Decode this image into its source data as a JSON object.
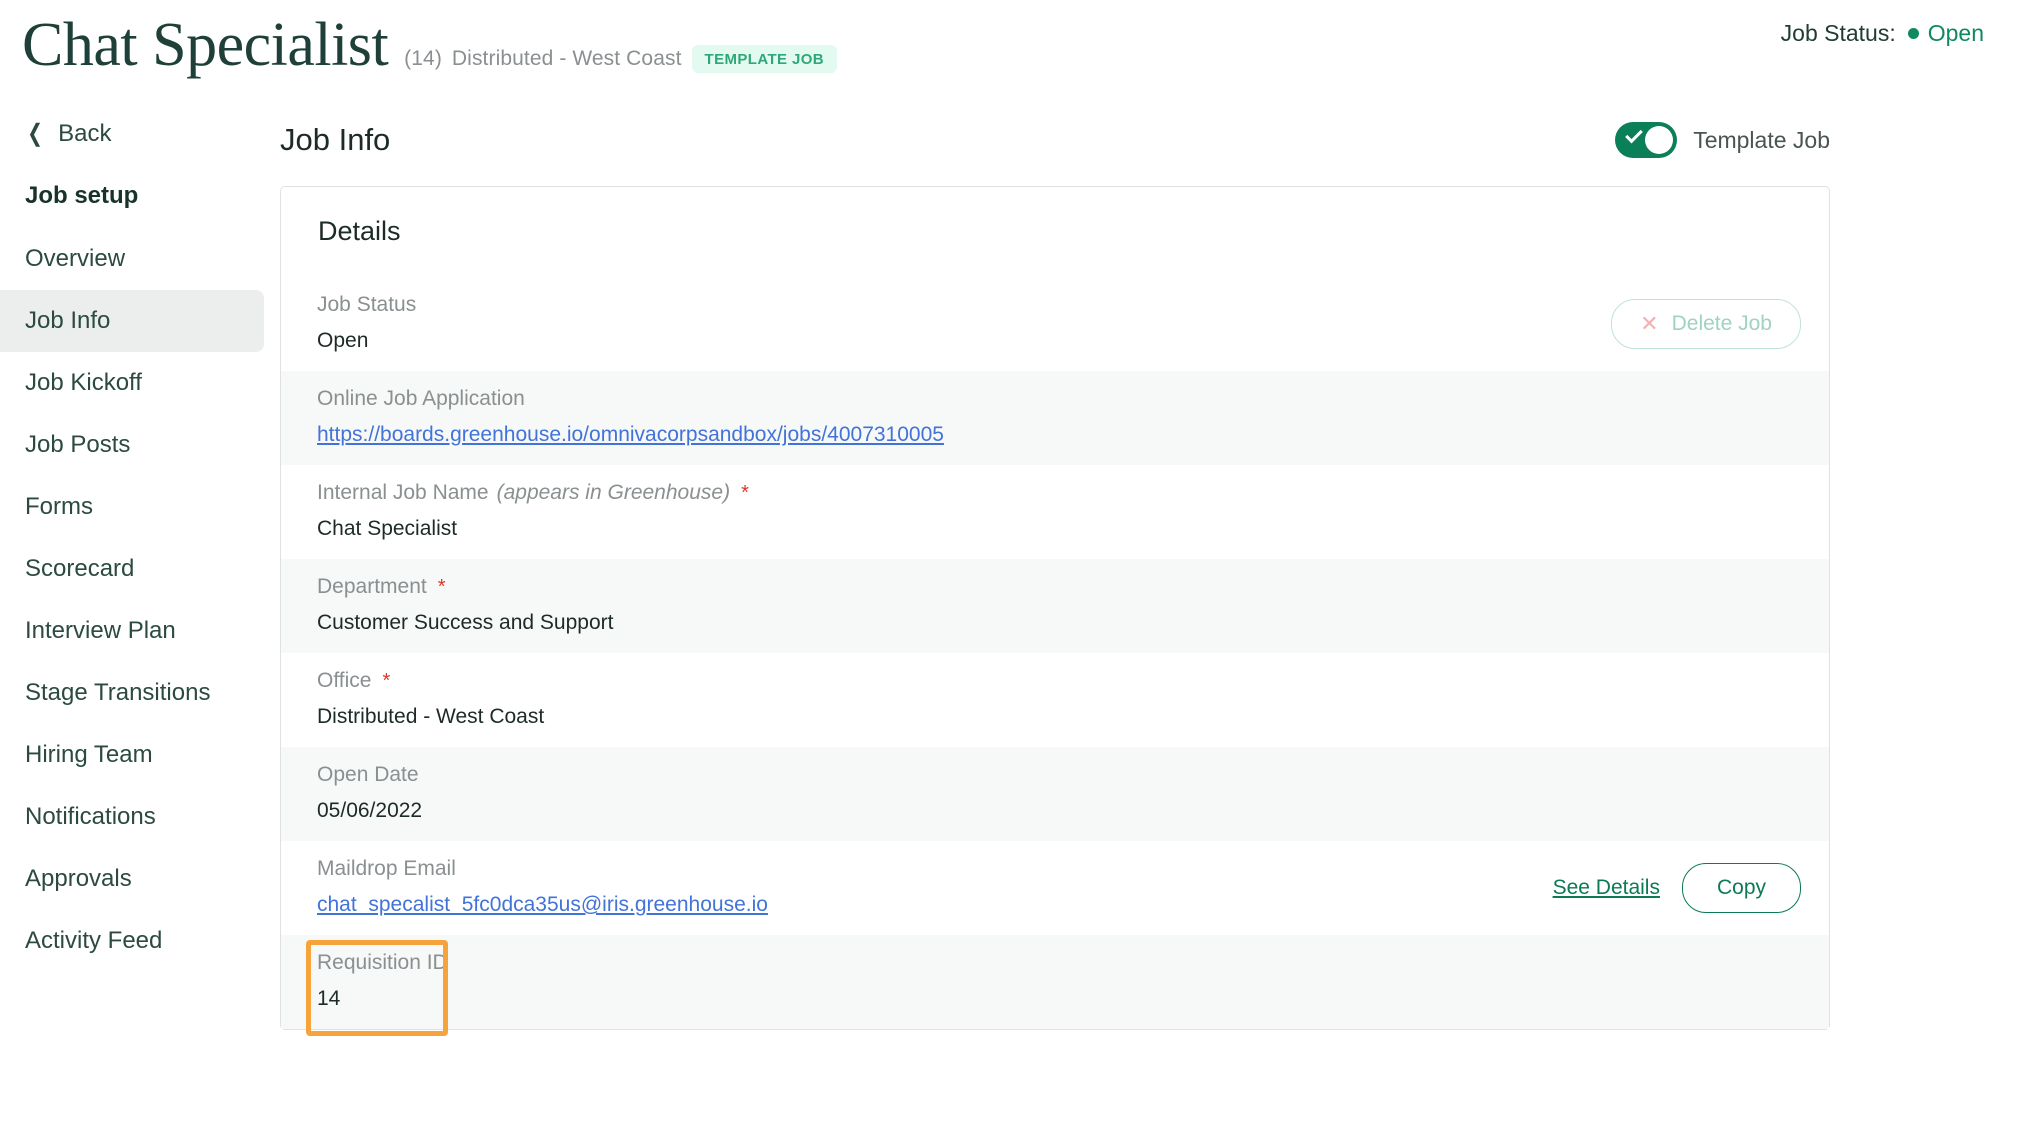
{
  "header": {
    "title": "Chat Specialist",
    "count": "(14)",
    "office": "Distributed - West Coast",
    "badge": "TEMPLATE JOB",
    "status_label": "Job Status:",
    "status_value": "Open",
    "status_color": "#0f8a5f",
    "badge_bg": "#e2faf0",
    "badge_color": "#2ea87a"
  },
  "sidebar": {
    "back_label": "Back",
    "back_icon": "chevron-left-icon",
    "heading": "Job setup",
    "items": [
      {
        "label": "Overview",
        "active": false
      },
      {
        "label": "Job Info",
        "active": true
      },
      {
        "label": "Job Kickoff",
        "active": false
      },
      {
        "label": "Job Posts",
        "active": false
      },
      {
        "label": "Forms",
        "active": false
      },
      {
        "label": "Scorecard",
        "active": false
      },
      {
        "label": "Interview Plan",
        "active": false
      },
      {
        "label": "Stage Transitions",
        "active": false
      },
      {
        "label": "Hiring Team",
        "active": false
      },
      {
        "label": "Notifications",
        "active": false
      },
      {
        "label": "Approvals",
        "active": false
      },
      {
        "label": "Activity Feed",
        "active": false
      }
    ]
  },
  "main": {
    "title": "Job Info",
    "toggle": {
      "label": "Template Job",
      "state": "on",
      "color": "#0a7f58",
      "icon": "check-icon"
    },
    "card": {
      "title": "Details",
      "rows": [
        {
          "label": "Job Status",
          "value": "Open",
          "value_type": "text",
          "striped": false,
          "required": false,
          "action": "delete"
        },
        {
          "label": "Online Job Application",
          "value": "https://boards.greenhouse.io/omnivacorpsandbox/jobs/4007310005",
          "value_type": "link",
          "striped": true,
          "required": false,
          "action": "none"
        },
        {
          "label": "Internal Job Name",
          "label_italic": "(appears in Greenhouse)",
          "value": "Chat Specialist",
          "value_type": "text",
          "striped": false,
          "required": true,
          "action": "none"
        },
        {
          "label": "Department",
          "value": "Customer Success and Support",
          "value_type": "text",
          "striped": true,
          "required": true,
          "action": "none"
        },
        {
          "label": "Office",
          "value": "Distributed - West Coast",
          "value_type": "text",
          "striped": false,
          "required": true,
          "action": "none"
        },
        {
          "label": "Open Date",
          "value": "05/06/2022",
          "value_type": "text",
          "striped": true,
          "required": false,
          "action": "none"
        },
        {
          "label": "Maildrop Email",
          "value": "chat_specalist_5fc0dca35us@iris.greenhouse.io",
          "value_type": "link",
          "striped": false,
          "required": false,
          "action": "maildrop"
        },
        {
          "label": "Requisition ID",
          "value": "14",
          "value_type": "text",
          "striped": true,
          "required": false,
          "action": "none",
          "annotated": true
        }
      ]
    },
    "buttons": {
      "delete_label": "Delete Job",
      "delete_icon": "x-icon",
      "see_details_label": "See Details",
      "copy_label": "Copy"
    },
    "annotation_color": "#f5a33a"
  }
}
